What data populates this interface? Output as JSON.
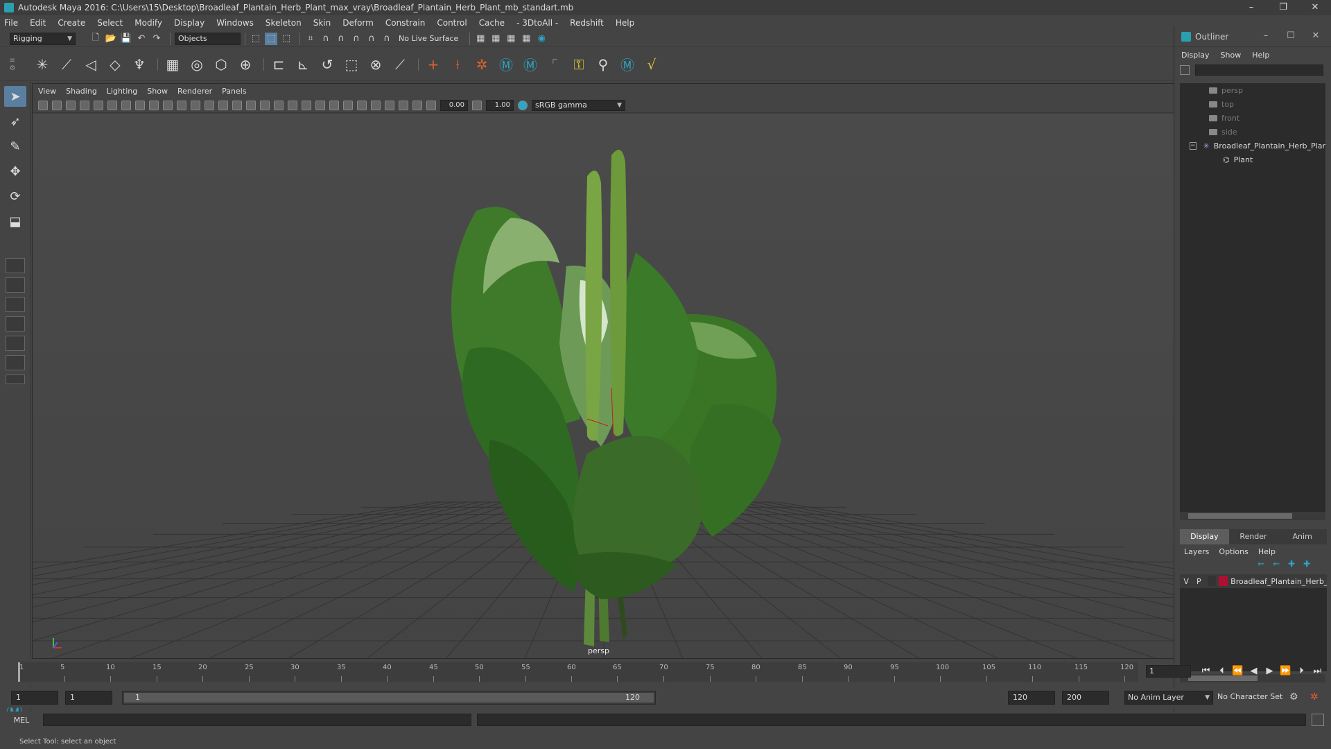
{
  "window": {
    "title": "Autodesk Maya 2016: C:\\Users\\15\\Desktop\\Broadleaf_Plantain_Herb_Plant_max_vray\\Broadleaf_Plantain_Herb_Plant_mb_standart.mb",
    "minimize": "–",
    "maximize": "❐",
    "close": "✕"
  },
  "menubar": [
    "File",
    "Edit",
    "Create",
    "Select",
    "Modify",
    "Display",
    "Windows",
    "Skeleton",
    "Skin",
    "Deform",
    "Constrain",
    "Control",
    "Cache",
    "- 3DtoAll -",
    "Redshift",
    "Help"
  ],
  "statusline": {
    "menuset": "Rigging",
    "selection_mode": "Objects",
    "live_surface": "No Live Surface"
  },
  "viewport": {
    "menu": [
      "View",
      "Shading",
      "Lighting",
      "Show",
      "Renderer",
      "Panels"
    ],
    "exposure": "0.00",
    "gamma": "1.00",
    "color_space": "sRGB gamma",
    "camera_label": "persp"
  },
  "outliner": {
    "title": "Outliner",
    "menu": [
      "Display",
      "Show",
      "Help"
    ],
    "cameras": [
      "persp",
      "top",
      "front",
      "side"
    ],
    "group": "Broadleaf_Plantain_Herb_Plant",
    "child": "Plant",
    "expander": "−"
  },
  "layers": {
    "tabs": [
      "Display",
      "Render",
      "Anim"
    ],
    "menu": [
      "Layers",
      "Options",
      "Help"
    ],
    "row": {
      "v": "V",
      "p": "P",
      "name": "Broadleaf_Plantain_Herb_Plant",
      "color": "#b01030"
    }
  },
  "timeline": {
    "ticks": [
      "5",
      "10",
      "15",
      "20",
      "25",
      "30",
      "35",
      "40",
      "45",
      "50",
      "55",
      "60",
      "65",
      "70",
      "75",
      "80",
      "85",
      "90",
      "95",
      "100",
      "105",
      "110",
      "115",
      "120"
    ],
    "start_label": "1",
    "current_frame": "1"
  },
  "range": {
    "start": "1",
    "playback_start": "1",
    "slider_start": "1",
    "slider_end": "120",
    "playback_end": "120",
    "end": "200",
    "anim_layer": "No Anim Layer",
    "character_set": "No Character Set"
  },
  "cmdline": {
    "label": "MEL"
  },
  "helpline": {
    "text": "Select Tool: select an object"
  }
}
